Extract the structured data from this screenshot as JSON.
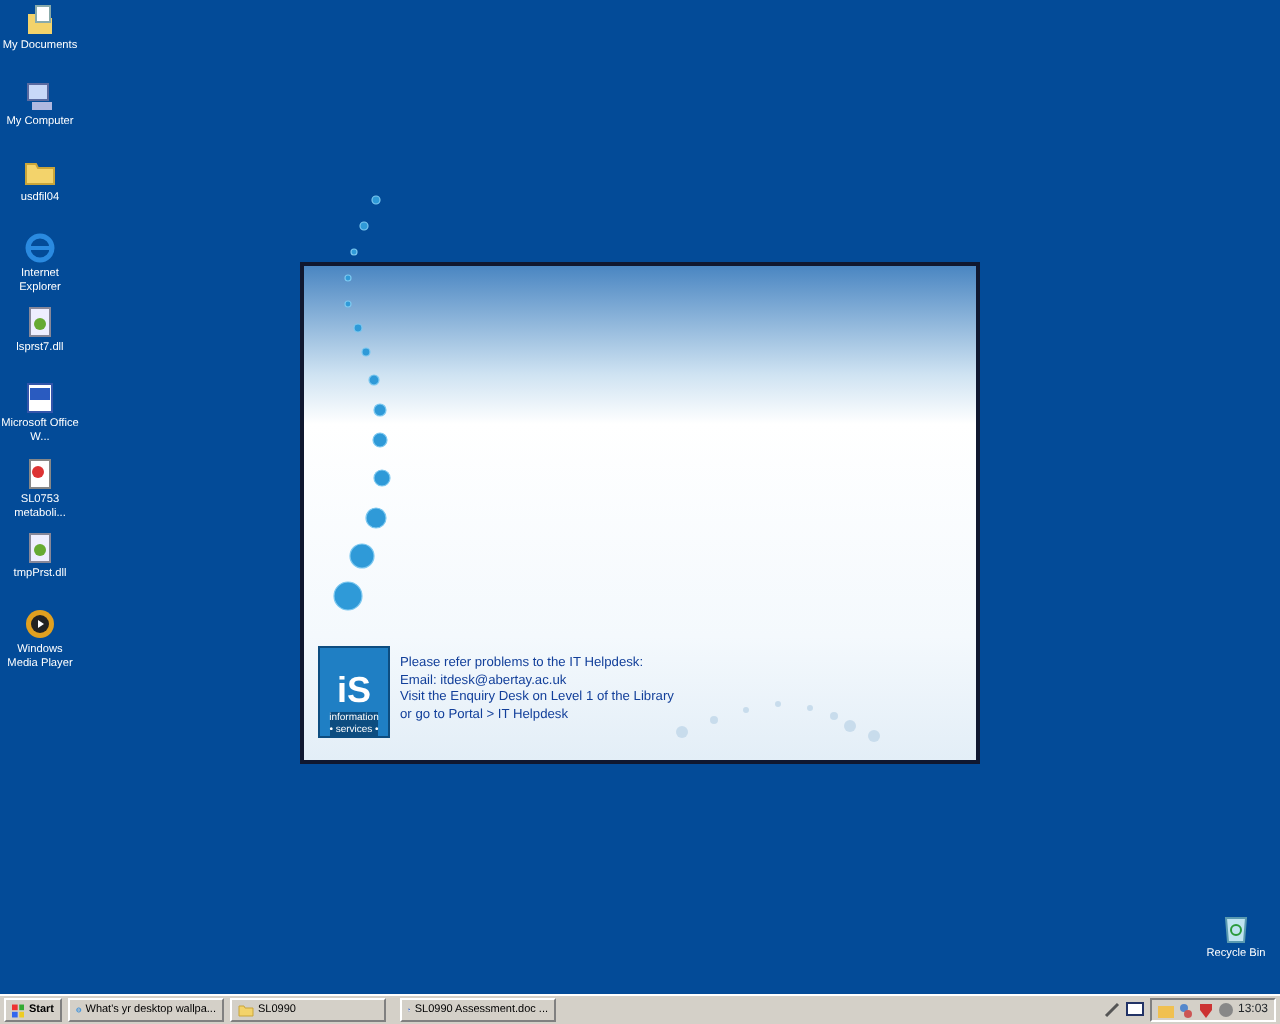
{
  "desktop_icons": [
    {
      "label": "My Documents",
      "kind": "documents"
    },
    {
      "label": "My Computer",
      "kind": "computer"
    },
    {
      "label": "usdfil04",
      "kind": "folder"
    },
    {
      "label": "Internet Explorer",
      "kind": "browser"
    },
    {
      "label": "lsprst7.dll",
      "kind": "dll"
    },
    {
      "label": "Microsoft Office W...",
      "kind": "word"
    },
    {
      "label": "SL0753 metaboli...",
      "kind": "pdf"
    },
    {
      "label": "tmpPrst.dll",
      "kind": "dll"
    },
    {
      "label": "Windows Media Player",
      "kind": "media"
    }
  ],
  "recycle_bin": {
    "label": "Recycle Bin"
  },
  "splash": {
    "logo": {
      "letters": "iS",
      "line_1": "information",
      "line_2": "• services •"
    },
    "lines": [
      "Please refer problems to the IT Helpdesk:",
      "Email: itdesk@abertay.ac.uk",
      "Visit the Enquiry Desk on Level 1 of the Library",
      "or go to Portal > IT Helpdesk"
    ]
  },
  "taskbar": {
    "start": "Start",
    "tasks": [
      {
        "label": "What's yr desktop wallpa...",
        "kind": "browser"
      },
      {
        "label": "SL0990",
        "kind": "folder"
      },
      {
        "label": "SL0990 Assessment.doc ...",
        "kind": "word"
      }
    ],
    "clock": "13:03"
  }
}
